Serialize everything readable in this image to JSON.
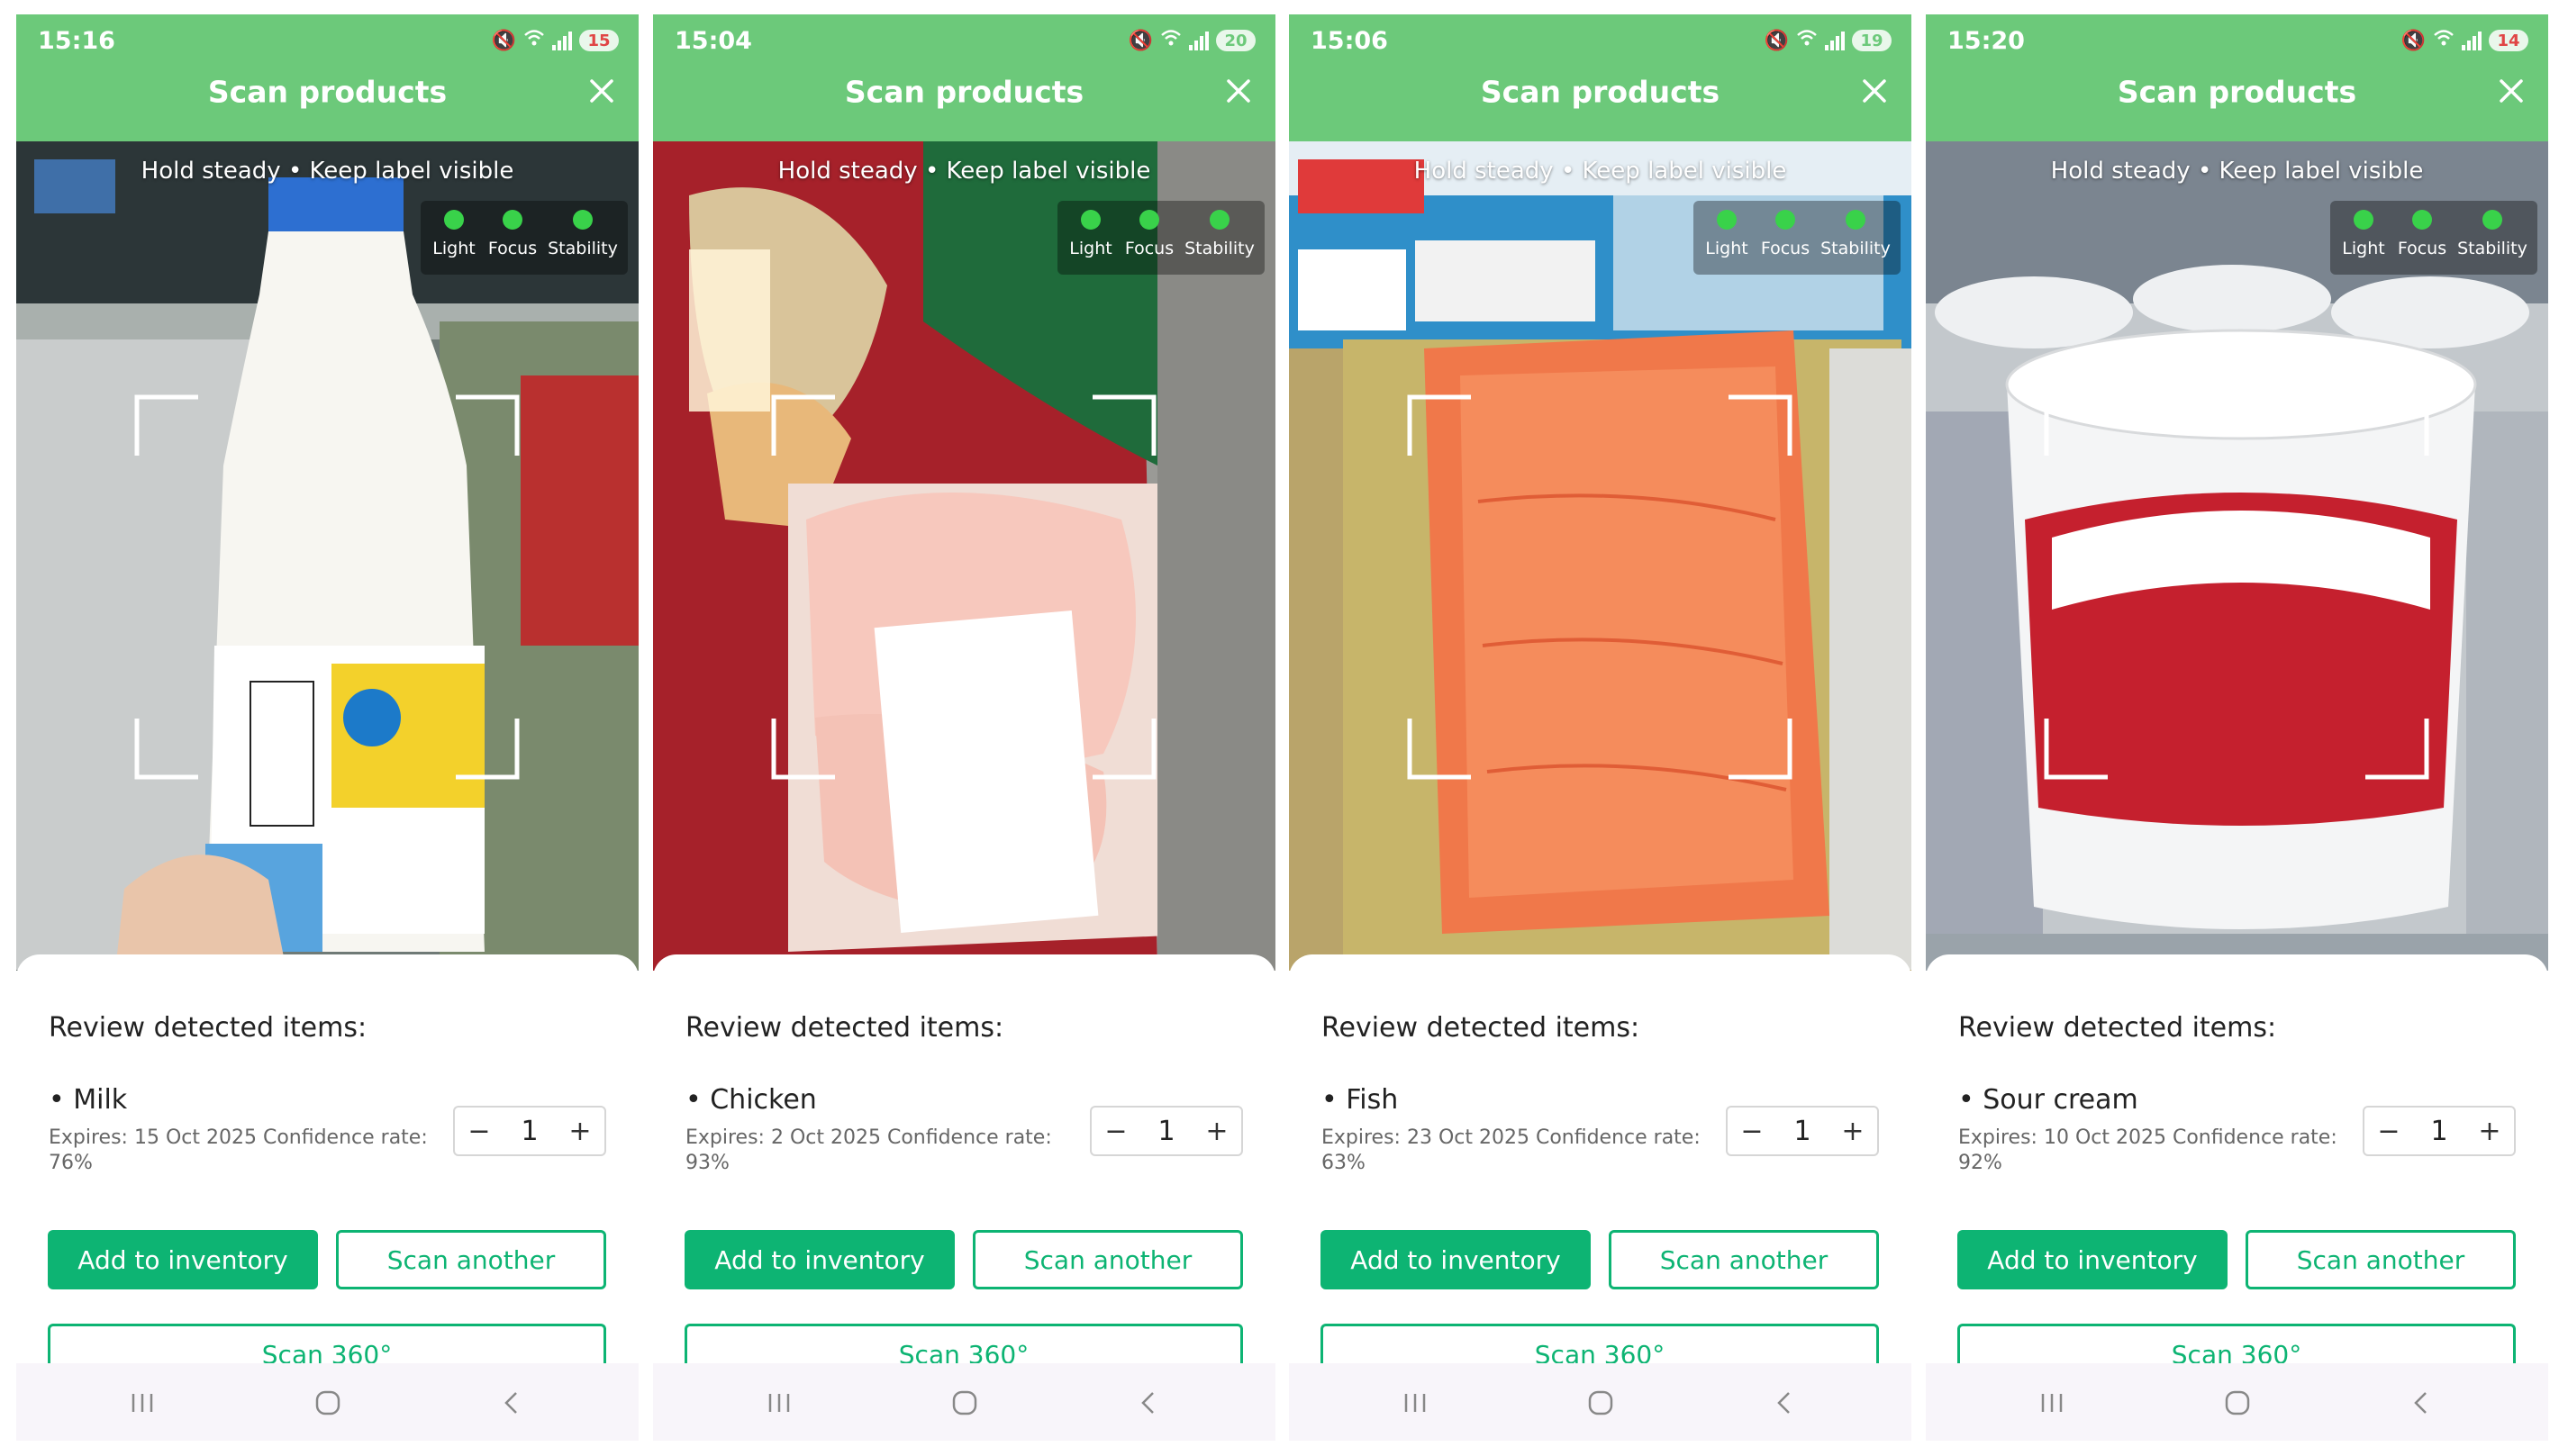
{
  "app": {
    "title": "Scan products",
    "hint": "Hold steady • Keep label visible",
    "indicators": [
      "Light",
      "Focus",
      "Stability"
    ],
    "review_title": "Review detected items:",
    "add_label": "Add to inventory",
    "scan_another_label": "Scan another",
    "scan360_label": "Scan 360°",
    "colors": {
      "header": "#6cc97a",
      "accent": "#0db473",
      "indicator_ok": "#39d24a"
    },
    "icons": [
      "mute-icon",
      "wifi-icon",
      "signal-icon",
      "battery-icon",
      "close-icon",
      "recents-icon",
      "home-icon",
      "back-icon"
    ]
  },
  "screens": [
    {
      "time": "15:16",
      "battery": "15",
      "battery_low": true,
      "item_label": "• Milk",
      "item_meta": "Expires: 15 Oct 2025 Confidence rate: 76%",
      "quantity": "1"
    },
    {
      "time": "15:04",
      "battery": "20",
      "battery_low": false,
      "item_label": "• Chicken",
      "item_meta": "Expires: 2 Oct 2025 Confidence rate: 93%",
      "quantity": "1"
    },
    {
      "time": "15:06",
      "battery": "19",
      "battery_low": false,
      "item_label": "• Fish",
      "item_meta": "Expires: 23 Oct 2025 Confidence rate: 63%",
      "quantity": "1"
    },
    {
      "time": "15:20",
      "battery": "14",
      "battery_low": true,
      "item_label": "• Sour cream",
      "item_meta": "Expires: 10 Oct 2025 Confidence rate: 92%",
      "quantity": "1"
    }
  ]
}
